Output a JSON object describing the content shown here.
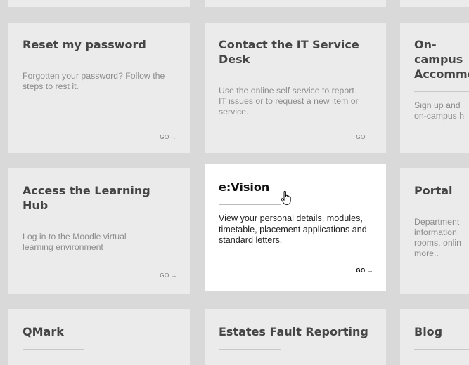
{
  "cards": [
    {
      "title": "Reset my password",
      "desc": "Forgotten your password? Follow the steps to rest it.",
      "go": "GO →"
    },
    {
      "title": "Contact the IT Service Desk",
      "desc": "Use the online self service to report IT issues or to request a new item or service.",
      "go": "GO →"
    },
    {
      "title": "On-campus Accommodation",
      "desc": "Sign up and on-campus h",
      "go": ""
    },
    {
      "title": "Access the Learning Hub",
      "desc": "Log in to the Moodle virtual learning environment",
      "go": "GO →"
    },
    {
      "title": "e:Vision",
      "desc": "View your personal details, modules, timetable, placement applications and standard letters.",
      "go": "GO →"
    },
    {
      "title": "Portal",
      "desc": "Department information rooms, onlin more..",
      "go": ""
    },
    {
      "title": "QMark",
      "desc": "",
      "go": ""
    },
    {
      "title": "Estates Fault Reporting",
      "desc": "",
      "go": ""
    },
    {
      "title": "Blog",
      "desc": "",
      "go": ""
    }
  ],
  "colors": {
    "background": "#d9d9d9",
    "card": "#ebebeb",
    "card_active": "#ffffff"
  },
  "cursor_icon": "hand-pointer-icon"
}
